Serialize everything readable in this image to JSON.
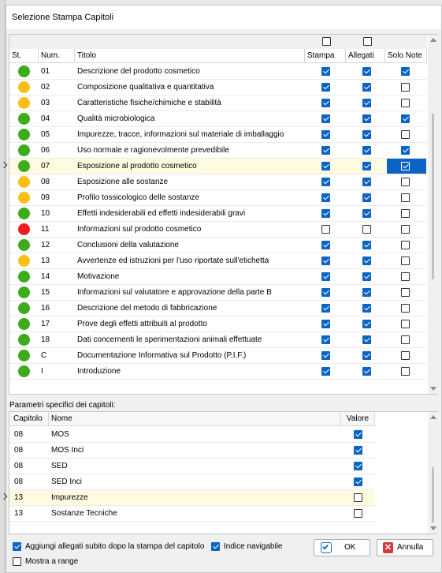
{
  "window": {
    "title": "Selezione Stampa Capitoli"
  },
  "colors": {
    "green": "#3cac1a",
    "orange": "#fbbf1a",
    "red": "#ea1e1e",
    "check": "#0b63c5"
  },
  "chapters": {
    "headers": {
      "st": "St.",
      "num": "Num.",
      "titolo": "Titolo",
      "stampa": "Stampa",
      "allegati": "Allegati",
      "solo_note": "Solo Note"
    },
    "header_toggles": {
      "stampa": false,
      "allegati": false
    },
    "rows": [
      {
        "status": "green",
        "num": "01",
        "title": "Descrizione del prodotto cosmetico",
        "stampa": true,
        "allegati": true,
        "note": true
      },
      {
        "status": "orange",
        "num": "02",
        "title": "Composizione qualitativa e quantitativa",
        "stampa": true,
        "allegati": true,
        "note": false
      },
      {
        "status": "orange",
        "num": "03",
        "title": "Caratteristiche fisiche/chimiche e stabilità",
        "stampa": true,
        "allegati": true,
        "note": false
      },
      {
        "status": "green",
        "num": "04",
        "title": "Qualità microbiologica",
        "stampa": true,
        "allegati": true,
        "note": true
      },
      {
        "status": "green",
        "num": "05",
        "title": "Impurezze, tracce, informazioni sul materiale di imballaggio",
        "stampa": true,
        "allegati": true,
        "note": false
      },
      {
        "status": "green",
        "num": "06",
        "title": "Uso normale e ragionevolmente prevedibile",
        "stampa": true,
        "allegati": true,
        "note": true
      },
      {
        "status": "green",
        "num": "07",
        "title": "Esposizione al prodotto cosmetico",
        "stampa": true,
        "allegati": true,
        "note": true,
        "selected": true
      },
      {
        "status": "orange",
        "num": "08",
        "title": "Esposizione alle sostanze",
        "stampa": true,
        "allegati": true,
        "note": false
      },
      {
        "status": "orange",
        "num": "09",
        "title": "Profilo tossicologico delle sostanze",
        "stampa": true,
        "allegati": true,
        "note": false
      },
      {
        "status": "green",
        "num": "10",
        "title": "Effetti indesiderabili ed effetti indesiderabili gravi",
        "stampa": true,
        "allegati": true,
        "note": false
      },
      {
        "status": "red",
        "num": "11",
        "title": "Informazioni sul prodotto cosmetico",
        "stampa": false,
        "allegati": false,
        "note": false
      },
      {
        "status": "green",
        "num": "12",
        "title": "Conclusioni della valutazione",
        "stampa": true,
        "allegati": true,
        "note": false
      },
      {
        "status": "orange",
        "num": "13",
        "title": "Avvertenze ed istruzioni per l'uso riportate sull'etichetta",
        "stampa": true,
        "allegati": true,
        "note": false
      },
      {
        "status": "green",
        "num": "14",
        "title": "Motivazione",
        "stampa": true,
        "allegati": true,
        "note": false
      },
      {
        "status": "green",
        "num": "15",
        "title": "Informazioni sul valutatore e approvazione della parte B",
        "stampa": true,
        "allegati": true,
        "note": false
      },
      {
        "status": "green",
        "num": "16",
        "title": "Descrizione del metodo di fabbricazione",
        "stampa": true,
        "allegati": true,
        "note": false
      },
      {
        "status": "green",
        "num": "17",
        "title": "Prove degli effetti attribuiti al prodotto",
        "stampa": true,
        "allegati": true,
        "note": false
      },
      {
        "status": "green",
        "num": "18",
        "title": "Dati concernenti le sperimentazioni animali effettuate",
        "stampa": true,
        "allegati": true,
        "note": false
      },
      {
        "status": "green",
        "num": "C",
        "title": "Documentazione Informativa sul Prodotto (P.I.F.)",
        "stampa": true,
        "allegati": true,
        "note": false
      },
      {
        "status": "green",
        "num": "I",
        "title": "Introduzione",
        "stampa": true,
        "allegati": true,
        "note": false
      }
    ]
  },
  "params": {
    "label": "Parametri specifici dei capitoli:",
    "headers": {
      "capitolo": "Capitolo",
      "nome": "Nome",
      "valore": "Valore"
    },
    "rows": [
      {
        "capitolo": "08",
        "nome": "MOS",
        "valore": true
      },
      {
        "capitolo": "08",
        "nome": "MOS Inci",
        "valore": true
      },
      {
        "capitolo": "08",
        "nome": "SED",
        "valore": true
      },
      {
        "capitolo": "08",
        "nome": "SED Inci",
        "valore": true
      },
      {
        "capitolo": "13",
        "nome": "Impurezze",
        "valore": false,
        "selected": true
      },
      {
        "capitolo": "13",
        "nome": "Sostanze Tecniche",
        "valore": false
      }
    ]
  },
  "footer": {
    "aggiungi_label": "Aggiungi allegati subito dopo la stampa del capitolo",
    "aggiungi": true,
    "indice_label": "Indice navigabile",
    "indice": true,
    "mostra_label": "Mostra a range",
    "mostra": false,
    "ok_label": "OK",
    "annulla_label": "Annulla"
  }
}
